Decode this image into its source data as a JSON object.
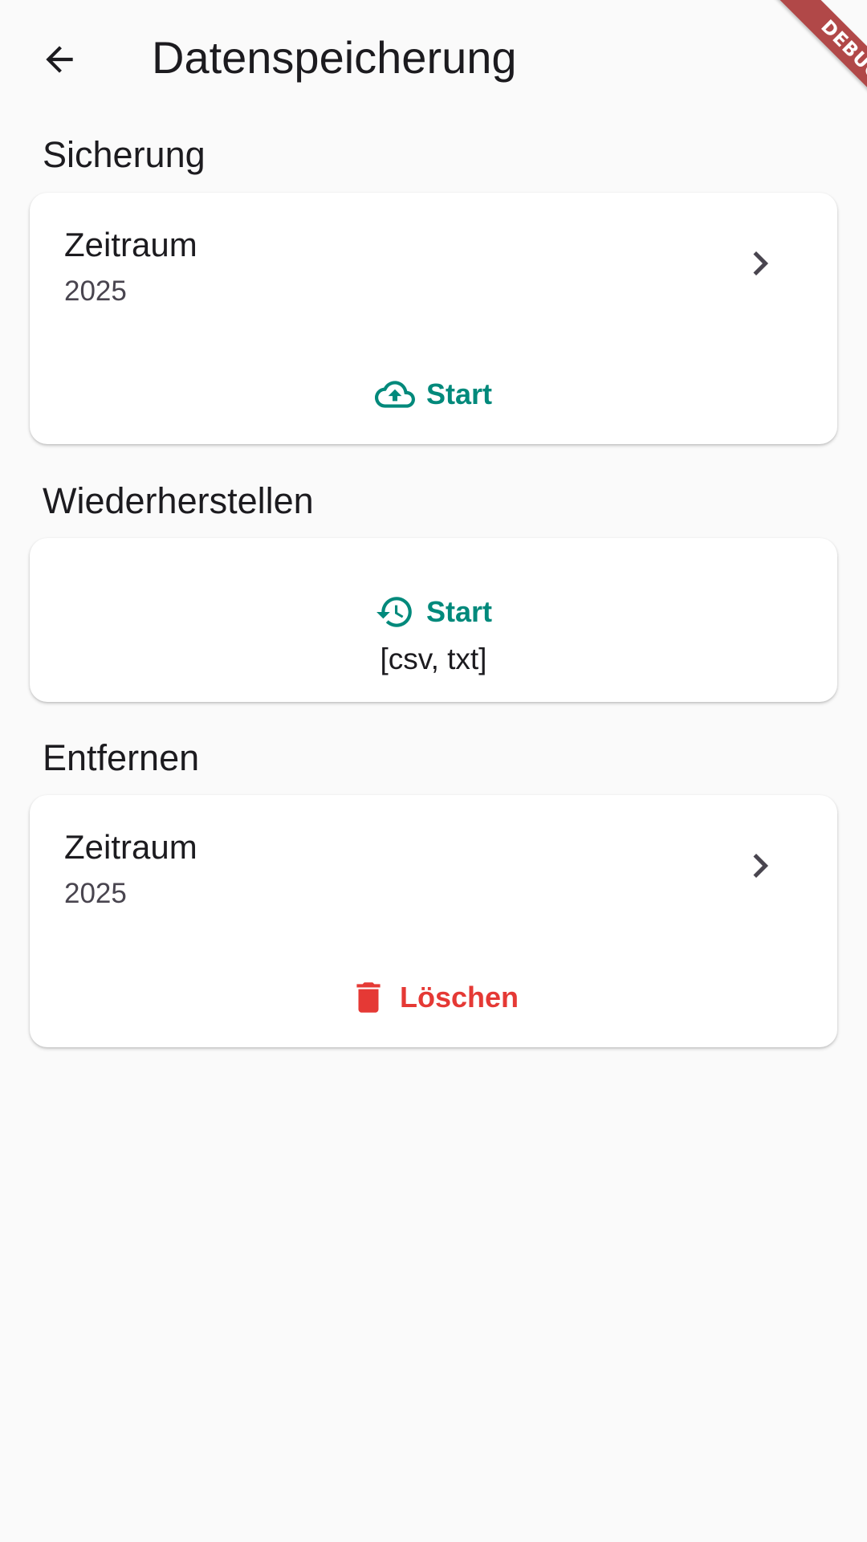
{
  "header": {
    "title": "Datenspeicherung",
    "back_icon": "arrow-back-icon"
  },
  "debug_banner": "DEBUG",
  "colors": {
    "accent": "#00897b",
    "danger": "#e53935",
    "background": "#fafafa",
    "card": "#ffffff"
  },
  "backup": {
    "section_title": "Sicherung",
    "period_label": "Zeitraum",
    "period_value": "2025",
    "action_label": "Start",
    "action_icon": "cloud-upload-icon"
  },
  "restore": {
    "section_title": "Wiederherstellen",
    "action_label": "Start",
    "action_icon": "restore-history-icon",
    "formats": "[csv, txt]"
  },
  "remove": {
    "section_title": "Entfernen",
    "period_label": "Zeitraum",
    "period_value": "2025",
    "action_label": "Löschen",
    "action_icon": "trash-icon"
  }
}
